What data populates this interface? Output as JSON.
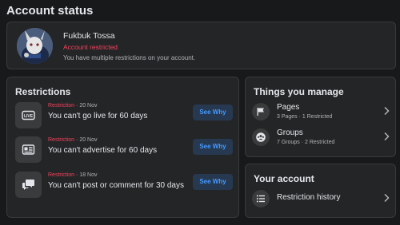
{
  "page": {
    "title": "Account status"
  },
  "status": {
    "name": "Fukbuk Tossa",
    "state": "Account restricted",
    "message": "You have multiple restrictions on your account.",
    "accent": "#f3425f"
  },
  "restrictions": {
    "title": "Restrictions",
    "items": [
      {
        "icon": "live-icon",
        "tag": "Restriction",
        "sep": " · ",
        "date": "20 Nov",
        "text": "You can't go live for 60 days",
        "button": "See Why"
      },
      {
        "icon": "ad-icon",
        "tag": "Restriction",
        "sep": " · ",
        "date": "20 Nov",
        "text": "You can't advertise for 60 days",
        "button": "See Why"
      },
      {
        "icon": "comment-icon",
        "tag": "Restriction",
        "sep": " · ",
        "date": "18 Nov",
        "text": "You can't post or comment for 30 days",
        "button": "See Why"
      }
    ]
  },
  "manage": {
    "title": "Things you manage",
    "items": [
      {
        "icon": "flag-icon",
        "label": "Pages",
        "sub": "3 Pages · 1 Restricted"
      },
      {
        "icon": "groups-icon",
        "label": "Groups",
        "sub": "7 Groups · 2 Restricted"
      }
    ]
  },
  "account": {
    "title": "Your account",
    "items": [
      {
        "icon": "list-icon",
        "label": "Restriction history"
      }
    ]
  },
  "colors": {
    "background": "#18191a",
    "card": "#242526",
    "button_bg": "#263951",
    "button_text": "#4599ff"
  }
}
